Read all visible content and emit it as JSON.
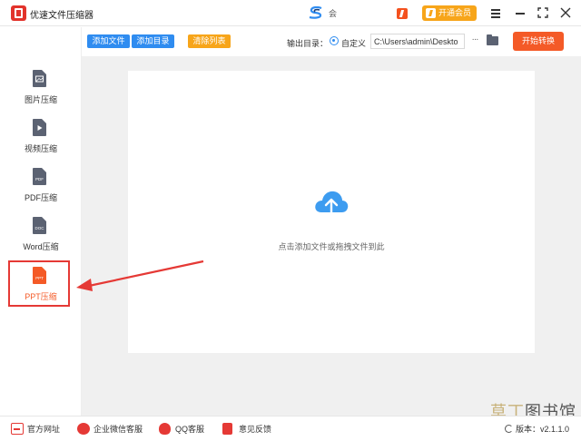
{
  "app": {
    "title": "优速文件压缩器",
    "brand_text": "会",
    "vip_label": "开通会员"
  },
  "toolbar": {
    "add_file": "添加文件",
    "add_dir": "添加目录",
    "clear_list": "清除列表",
    "output_label": "输出目录：",
    "custom_label": "自定义",
    "output_path": "C:\\Users\\admin\\Deskto",
    "more_label": "···",
    "start_label": "开始转换"
  },
  "sidebar": {
    "items": [
      {
        "label": "图片压缩",
        "tag": ""
      },
      {
        "label": "视频压缩",
        "tag": ""
      },
      {
        "label": "PDF压缩",
        "tag": "PDF"
      },
      {
        "label": "Word压缩",
        "tag": "DOC"
      },
      {
        "label": "PPT压缩",
        "tag": "PPT",
        "active": true
      }
    ]
  },
  "main": {
    "drop_hint": "点击添加文件或拖拽文件到此"
  },
  "footer": {
    "website": "官方网址",
    "wechat": "企业微信客服",
    "qq": "QQ客服",
    "feedback": "意见反馈",
    "version": "版本：v2.1.1.0"
  },
  "watermark": {
    "part1": "草丁",
    "part2": "图书馆"
  },
  "colors": {
    "accent_blue": "#2f8cf0",
    "accent_orange": "#f45a27",
    "vip_orange": "#f7a51a",
    "highlight_red": "#e53935"
  }
}
